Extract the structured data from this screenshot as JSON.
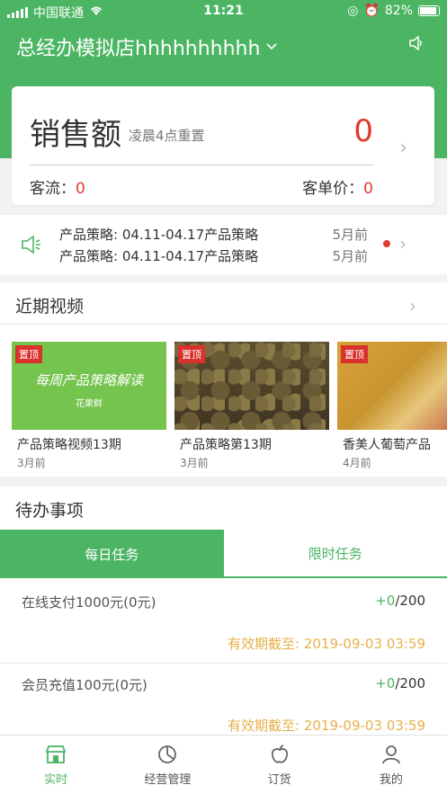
{
  "status_bar": {
    "carrier": "中国联通",
    "time": "11:21",
    "battery": "82%"
  },
  "header": {
    "store_name": "总经办模拟店hhhhhhhhhh"
  },
  "sales": {
    "title": "销售额",
    "subtitle": "凌晨4点重置",
    "value": "0",
    "traffic_label": "客流：",
    "traffic_value": "0",
    "avg_label": "客单价：",
    "avg_value": "0"
  },
  "notices": [
    {
      "text": "产品策略: 04.11-04.17产品策略",
      "time": "5月前"
    },
    {
      "text": "产品策略: 04.11-04.17产品策略",
      "time": "5月前"
    }
  ],
  "videos": {
    "title": "近期视频",
    "badge": "置顶",
    "items": [
      {
        "title": "产品策略视频13期",
        "time": "3月前",
        "thumb_text": "每周产品策略解读",
        "thumb_logo": "花果鲜"
      },
      {
        "title": "产品策略第13期",
        "time": "3月前"
      },
      {
        "title": "香美人葡萄产品",
        "time": "4月前"
      }
    ]
  },
  "todo": {
    "title": "待办事项",
    "tabs": [
      "每日任务",
      "限时任务"
    ],
    "tasks": [
      {
        "name": "在线支付1000元(0元)",
        "progress": "+0",
        "total": "/200",
        "expiry": "有效期截至: 2019-09-03 03:59"
      },
      {
        "name": "会员充值100元(0元)",
        "progress": "+0",
        "total": "/200",
        "expiry": "有效期截至: 2019-09-03 03:59"
      }
    ]
  },
  "tabbar": [
    "实时",
    "经营管理",
    "订货",
    "我的"
  ],
  "colors": {
    "brand": "#4cb564",
    "red": "#e0392d",
    "expiry": "#e7b04a"
  }
}
